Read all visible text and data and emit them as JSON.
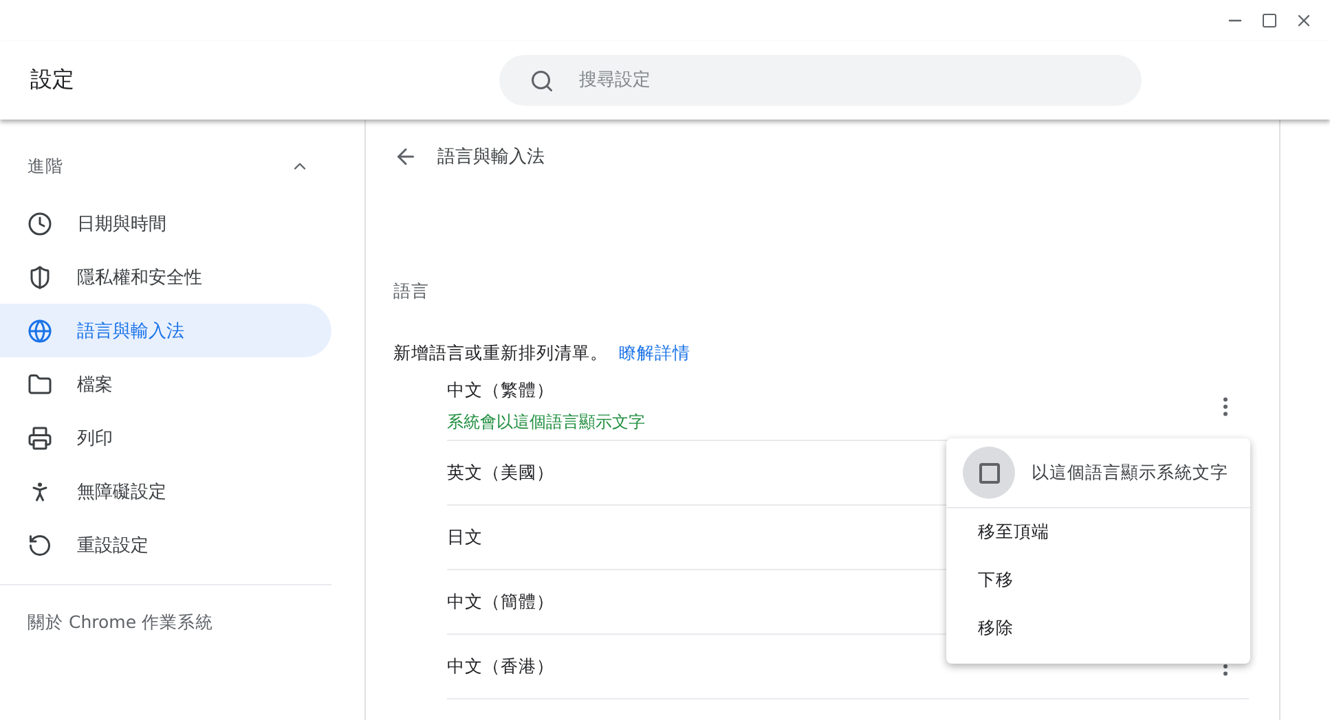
{
  "header": {
    "title": "設定",
    "search": {
      "placeholder": "搜尋設定"
    }
  },
  "sidebar": {
    "section": {
      "label": "進階",
      "expanded": true
    },
    "items": [
      {
        "label": "日期與時間",
        "selected": false
      },
      {
        "label": "隱私權和安全性",
        "selected": false
      },
      {
        "label": "語言與輸入法",
        "selected": true
      },
      {
        "label": "檔案",
        "selected": false
      },
      {
        "label": "列印",
        "selected": false
      },
      {
        "label": "無障礙設定",
        "selected": false
      },
      {
        "label": "重設設定",
        "selected": false
      }
    ],
    "about": "關於 Chrome 作業系統"
  },
  "page": {
    "title": "語言與輸入法",
    "section_title": "語言",
    "description": "新增語言或重新排列清單。",
    "link": "瞭解詳情",
    "languages": [
      {
        "name": "中文（繁體）",
        "note": "系統會以這個語言顯示文字"
      },
      {
        "name": "英文（美國）"
      },
      {
        "name": "日文"
      },
      {
        "name": "中文（簡體）"
      },
      {
        "name": "中文（香港）"
      }
    ]
  },
  "menu": {
    "checkbox": {
      "label": "以這個語言顯示系統文字",
      "checked": false
    },
    "items": [
      "移至頂端",
      "下移",
      "移除"
    ]
  }
}
